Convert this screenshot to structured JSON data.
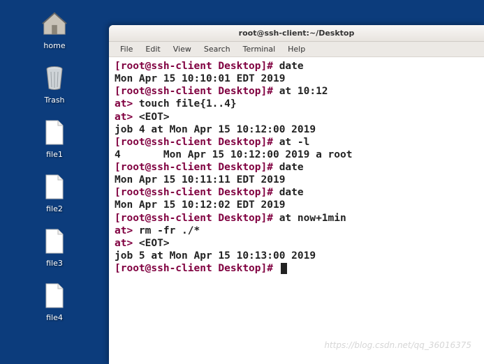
{
  "desktop": {
    "icons": [
      {
        "label": "home",
        "kind": "home"
      },
      {
        "label": "Trash",
        "kind": "trash"
      },
      {
        "label": "file1",
        "kind": "file"
      },
      {
        "label": "file2",
        "kind": "file"
      },
      {
        "label": "file3",
        "kind": "file"
      },
      {
        "label": "file4",
        "kind": "file"
      }
    ]
  },
  "window": {
    "title": "root@ssh-client:~/Desktop",
    "menu": [
      "File",
      "Edit",
      "View",
      "Search",
      "Terminal",
      "Help"
    ]
  },
  "terminal": {
    "prompt": "[root@ssh-client Desktop]# ",
    "at_prompt": "at> ",
    "lines": [
      {
        "t": "p",
        "cmd": "date"
      },
      {
        "t": "o",
        "text": "Mon Apr 15 10:10:01 EDT 2019"
      },
      {
        "t": "p",
        "cmd": "at 10:12"
      },
      {
        "t": "a",
        "cmd": "touch file{1..4}"
      },
      {
        "t": "a",
        "cmd": "<EOT>"
      },
      {
        "t": "o",
        "text": "job 4 at Mon Apr 15 10:12:00 2019"
      },
      {
        "t": "p",
        "cmd": "at -l"
      },
      {
        "t": "o",
        "text": "4       Mon Apr 15 10:12:00 2019 a root"
      },
      {
        "t": "p",
        "cmd": "date"
      },
      {
        "t": "o",
        "text": "Mon Apr 15 10:11:11 EDT 2019"
      },
      {
        "t": "p",
        "cmd": "date"
      },
      {
        "t": "o",
        "text": "Mon Apr 15 10:12:02 EDT 2019"
      },
      {
        "t": "p",
        "cmd": "at now+1min"
      },
      {
        "t": "a",
        "cmd": "rm -fr ./*"
      },
      {
        "t": "a",
        "cmd": "<EOT>"
      },
      {
        "t": "o",
        "text": "job 5 at Mon Apr 15 10:13:00 2019"
      },
      {
        "t": "p",
        "cmd": "",
        "cursor": true
      }
    ]
  },
  "watermark": "https://blog.csdn.net/qq_36016375"
}
